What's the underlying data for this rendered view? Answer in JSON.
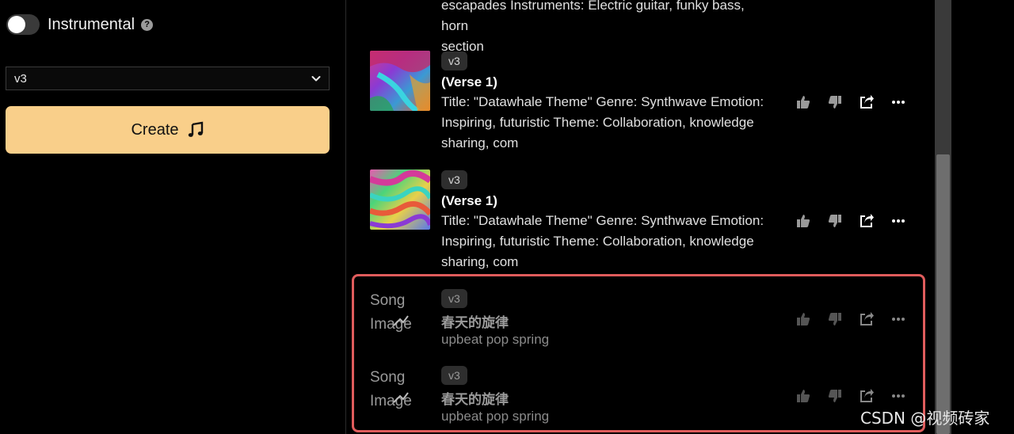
{
  "left": {
    "instrumental_label": "Instrumental",
    "instrumental_on": false,
    "model_select": {
      "value": "v3"
    },
    "create_label": "Create"
  },
  "top_fragment": {
    "line1": "escapades Instruments: Electric guitar, funky bass, horn",
    "line2": "section"
  },
  "songs": [
    {
      "badge": "v3",
      "title": "(Verse 1)",
      "desc_lines": [
        "Title: \"Datawhale Theme\" Genre: Synthwave Emotion:",
        "Inspiring, futuristic Theme: Collaboration, knowledge",
        "sharing, com"
      ],
      "thumb": "image"
    },
    {
      "badge": "v3",
      "title": "(Verse 1)",
      "desc_lines": [
        "Title: \"Datawhale Theme\" Genre: Synthwave Emotion:",
        "Inspiring, futuristic Theme: Collaboration, knowledge",
        "sharing, com"
      ],
      "thumb": "image"
    },
    {
      "badge": "v3",
      "title": "春天的旋律",
      "desc_lines": [
        "upbeat pop spring"
      ],
      "thumb": "broken",
      "alt_line1": "Song",
      "alt_line2": "Image"
    },
    {
      "badge": "v3",
      "title": "春天的旋律",
      "desc_lines": [
        "upbeat pop spring"
      ],
      "thumb": "broken",
      "alt_line1": "Song",
      "alt_line2": "Image"
    }
  ],
  "watermark": "CSDN @视频砖家",
  "colors": {
    "accent": "#f9cf8a",
    "highlight": "#e05c5c"
  },
  "icons": [
    "help-icon",
    "chevron-down-icon",
    "music-note-icon",
    "thumbs-up-icon",
    "thumbs-down-icon",
    "share-icon",
    "more-icon"
  ]
}
